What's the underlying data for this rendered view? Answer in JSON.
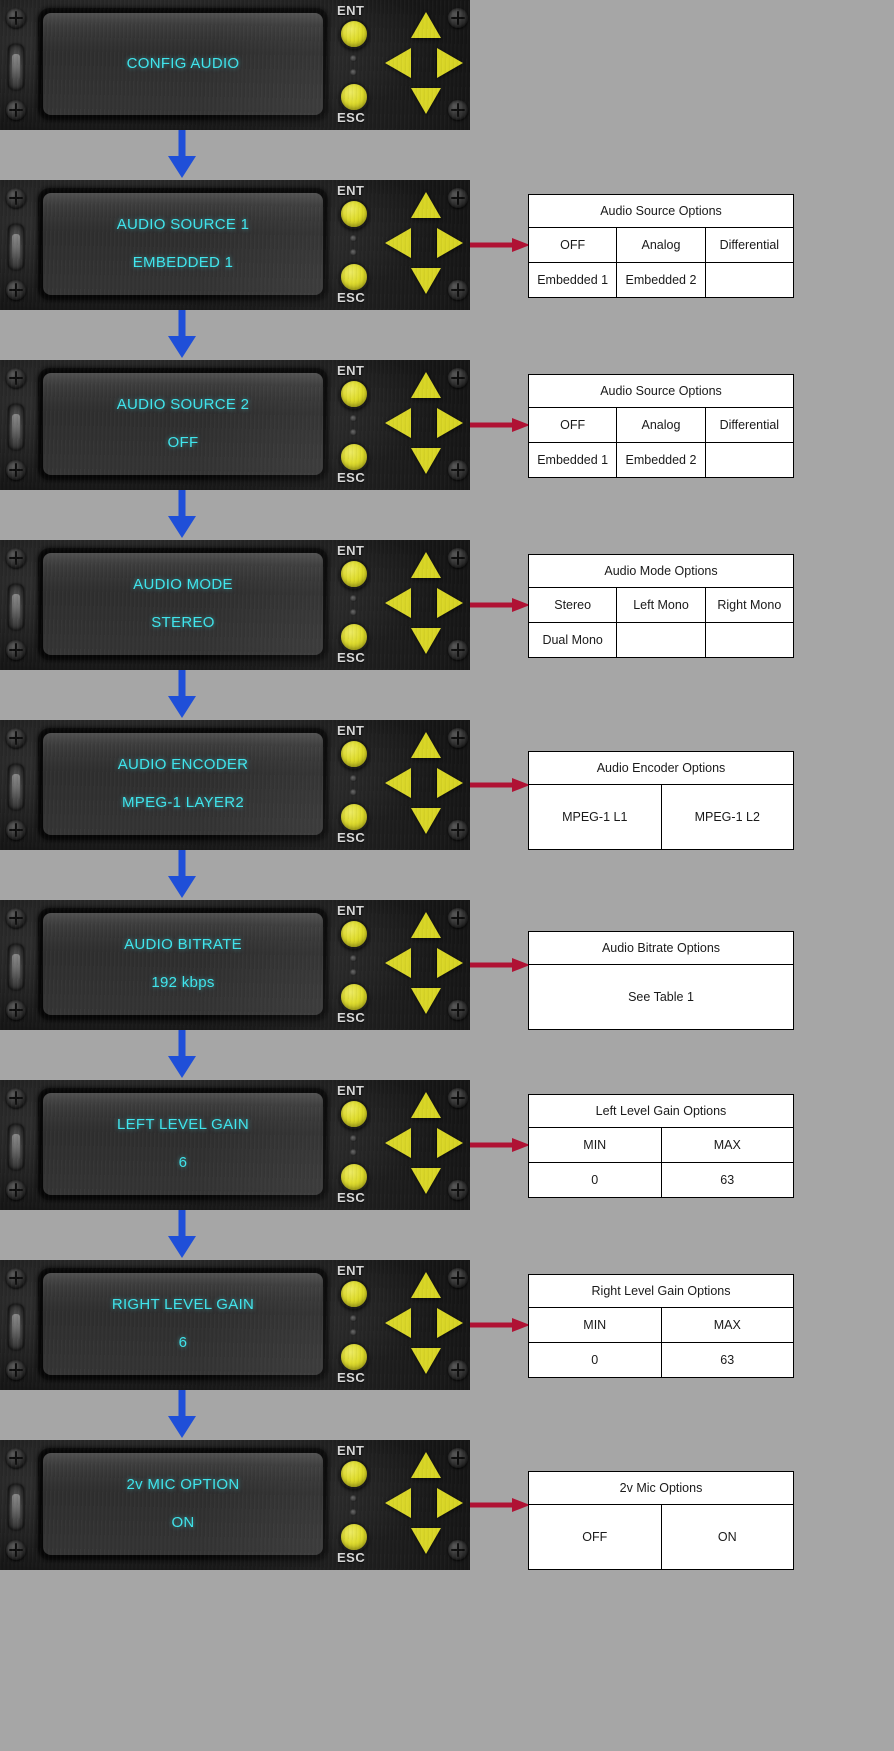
{
  "page": {
    "background_color": "#a6a6a6",
    "lcd_text_color": "#3fe7ef",
    "connector_arrow_color": "#1f4fd8",
    "pointer_arrow_color": "#b01234",
    "panel_button_color": "#d9d623"
  },
  "panel_controls": {
    "ent_label": "ENT",
    "esc_label": "ESC",
    "arrow_up": "up-arrow",
    "arrow_down": "down-arrow",
    "arrow_left": "left-arrow",
    "arrow_right": "right-arrow"
  },
  "steps": [
    {
      "id": "config-audio",
      "display": {
        "line1": "CONFIG AUDIO",
        "line2": ""
      },
      "has_table": false,
      "table": null
    },
    {
      "id": "audio-source-1",
      "display": {
        "line1": "AUDIO SOURCE 1",
        "line2": "EMBEDDED 1"
      },
      "has_table": true,
      "table": {
        "title": "Audio Source Options",
        "rows": [
          [
            "OFF",
            "Analog",
            "Differential"
          ],
          [
            "Embedded 1",
            "Embedded 2",
            ""
          ]
        ]
      }
    },
    {
      "id": "audio-source-2",
      "display": {
        "line1": "AUDIO SOURCE 2",
        "line2": "OFF"
      },
      "has_table": true,
      "table": {
        "title": "Audio Source Options",
        "rows": [
          [
            "OFF",
            "Analog",
            "Differential"
          ],
          [
            "Embedded 1",
            "Embedded 2",
            ""
          ]
        ]
      }
    },
    {
      "id": "audio-mode",
      "display": {
        "line1": "AUDIO MODE",
        "line2": "STEREO"
      },
      "has_table": true,
      "table": {
        "title": "Audio Mode Options",
        "rows": [
          [
            "Stereo",
            "Left Mono",
            "Right Mono"
          ],
          [
            "Dual Mono",
            "",
            ""
          ]
        ]
      }
    },
    {
      "id": "audio-encoder",
      "display": {
        "line1": "AUDIO ENCODER",
        "line2": "MPEG-1 LAYER2"
      },
      "has_table": true,
      "table": {
        "title": "Audio Encoder Options",
        "rows": [
          [
            "MPEG-1 L1",
            "MPEG-1 L2"
          ]
        ]
      }
    },
    {
      "id": "audio-bitrate",
      "display": {
        "line1": "AUDIO BITRATE",
        "line2": "192 kbps"
      },
      "has_table": true,
      "table": {
        "title": "Audio Bitrate Options",
        "rows": [
          [
            "See Table 1"
          ]
        ]
      }
    },
    {
      "id": "left-level-gain",
      "display": {
        "line1": "LEFT LEVEL GAIN",
        "line2": "6"
      },
      "has_table": true,
      "table": {
        "title": "Left Level Gain Options",
        "rows": [
          [
            "MIN",
            "MAX"
          ],
          [
            "0",
            "63"
          ]
        ]
      }
    },
    {
      "id": "right-level-gain",
      "display": {
        "line1": "RIGHT LEVEL GAIN",
        "line2": "6"
      },
      "has_table": true,
      "table": {
        "title": "Right Level Gain Options",
        "rows": [
          [
            "MIN",
            "MAX"
          ],
          [
            "0",
            "63"
          ]
        ]
      }
    },
    {
      "id": "2v-mic-option",
      "display": {
        "line1": "2v MIC OPTION",
        "line2": "ON"
      },
      "has_table": true,
      "table": {
        "title": "2v Mic Options",
        "rows": [
          [
            "OFF",
            "ON"
          ]
        ]
      }
    }
  ]
}
